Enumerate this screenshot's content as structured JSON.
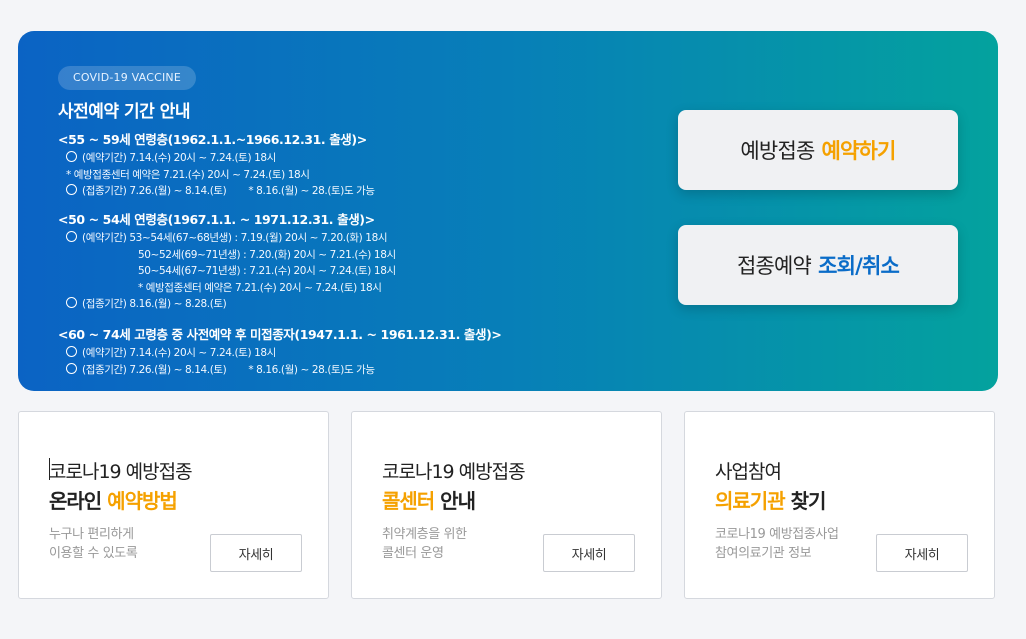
{
  "hero": {
    "badge": "COVID-19 VACCINE",
    "title": "사전예약 기간 안내",
    "groups": [
      {
        "title": "<55 ~ 59세 연령층(1962.1.1.~1966.12.31. 출생)>",
        "lines": [
          {
            "circle": true,
            "text": "(예약기간) 7.14.(수) 20시 ~ 7.24.(토) 18시"
          },
          {
            "circle": false,
            "text": "* 예방접종센터 예약은 7.21.(수) 20시 ~ 7.24.(토) 18시"
          },
          {
            "circle": true,
            "text": "(접종기간) 7.26.(월) ~ 8.14.(토)",
            "note": "* 8.16.(월) ~ 28.(토)도 가능"
          }
        ]
      },
      {
        "title": "<50 ~ 54세 연령층(1967.1.1. ~ 1971.12.31. 출생)>",
        "lines": [
          {
            "circle": true,
            "text": "(예약기간) 53~54세(67~68년생) : 7.19.(월) 20시 ~ 7.20.(화) 18시"
          },
          {
            "indent": true,
            "text": "50~52세(69~71년생) : 7.20.(화) 20시 ~ 7.21.(수) 18시"
          },
          {
            "indent": true,
            "text": "50~54세(67~71년생) : 7.21.(수) 20시 ~ 7.24.(토) 18시"
          },
          {
            "indent": true,
            "text": "* 예방접종센터 예약은 7.21.(수) 20시 ~ 7.24.(토) 18시"
          },
          {
            "circle": true,
            "text": "(접종기간) 8.16.(월) ~ 8.28.(토)"
          }
        ]
      },
      {
        "title": "<60 ~ 74세 고령층 중 사전예약 후 미접종자(1947.1.1. ~ 1961.12.31. 출생)>",
        "lines": [
          {
            "circle": true,
            "text": "(예약기간) 7.14.(수) 20시 ~ 7.24.(토) 18시"
          },
          {
            "circle": true,
            "text": "(접종기간) 7.26.(월) ~ 8.14.(토)",
            "note": "* 8.16.(월) ~ 28.(토)도 가능"
          }
        ]
      }
    ],
    "reserve_button": {
      "prefix": "예방접종",
      "emphasis": "예약하기",
      "color": "#f5a100"
    },
    "lookup_button": {
      "prefix": "접종예약",
      "emphasis": "조회/취소",
      "color": "#0a6cc8"
    }
  },
  "cards": [
    {
      "line1": "코로나19 예방접종",
      "line2_a": "온라인 ",
      "line2_hl": "예약방법",
      "line2_b": "",
      "desc": [
        "누구나 편리하게",
        "이용할 수 있도록"
      ],
      "button": "자세히"
    },
    {
      "line1": "코로나19 예방접종",
      "line2_a": "",
      "line2_hl": "콜센터",
      "line2_b": " 안내",
      "desc": [
        "취약계층을 위한",
        "콜센터 운영"
      ],
      "button": "자세히"
    },
    {
      "line1": "사업참여",
      "line2_a": "",
      "line2_hl": "의료기관",
      "line2_b": " 찾기",
      "desc": [
        "코로나19 예방접종사업",
        "참여의료기관 정보"
      ],
      "button": "자세히"
    }
  ],
  "colors": {
    "accent_orange": "#f5a100",
    "accent_blue": "#0a6cc8",
    "hero_start": "#0b63c4",
    "hero_end": "#04a29e"
  }
}
